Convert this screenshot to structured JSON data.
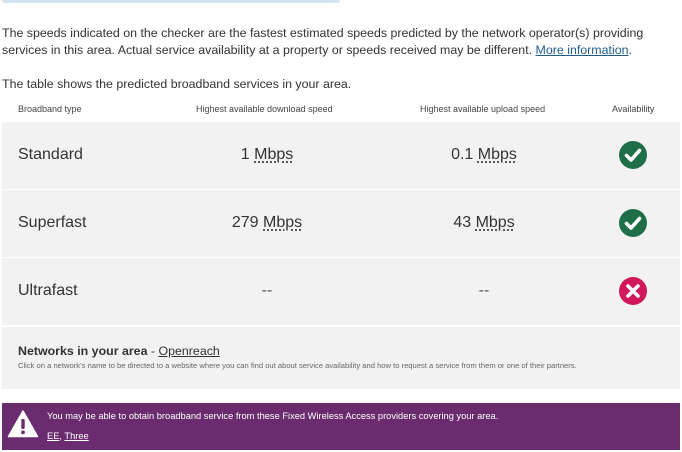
{
  "intro": {
    "text": "The speeds indicated on the checker are the fastest estimated speeds predicted by the network operator(s) providing services in this area. Actual service availability at a property or speeds received may be different.",
    "link": "More information",
    "link_suffix": "."
  },
  "table_intro": "The table shows the predicted broadband services in your area.",
  "columns": {
    "type": "Broadband type",
    "download": "Highest available download speed",
    "upload": "Highest available upload speed",
    "availability": "Availability"
  },
  "rows": [
    {
      "type": "Standard",
      "down_value": "1",
      "down_unit": "Mbps",
      "up_value": "0.1",
      "up_unit": "Mbps",
      "available": true
    },
    {
      "type": "Superfast",
      "down_value": "279",
      "down_unit": "Mbps",
      "up_value": "43",
      "up_unit": "Mbps",
      "available": true
    },
    {
      "type": "Ultrafast",
      "down_value": "--",
      "down_unit": "",
      "up_value": "--",
      "up_unit": "",
      "available": false
    }
  ],
  "networks": {
    "label": "Networks in your area",
    "separator": " - ",
    "provider": "Openreach",
    "note": "Click on a network’s name to be directed to a website where you can find out about service availability and how to request a service from them or one of their partners."
  },
  "fwa": {
    "text": "You may be able to obtain broadband service from these Fixed Wireless Access providers covering your area.",
    "providers": [
      "EE",
      "Three"
    ],
    "separator": ", "
  },
  "colors": {
    "available": "#1e6f47",
    "unavailable": "#d1185b",
    "banner": "#6a2c6e",
    "link": "#1d5b8d"
  },
  "icons": {
    "available": "check-circle-icon",
    "unavailable": "cross-circle-icon",
    "warning": "warning-triangle-icon"
  }
}
